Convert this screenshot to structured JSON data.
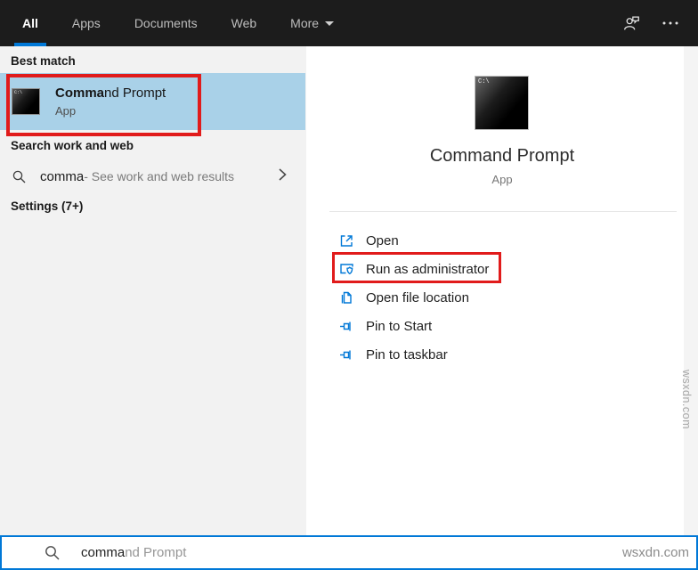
{
  "topbar": {
    "tabs": [
      {
        "label": "All",
        "active": true
      },
      {
        "label": "Apps",
        "active": false
      },
      {
        "label": "Documents",
        "active": false
      },
      {
        "label": "Web",
        "active": false
      },
      {
        "label": "More",
        "active": false,
        "icon": "dropdown-caret-icon"
      }
    ],
    "icons": [
      {
        "name": "feedback-icon"
      },
      {
        "name": "more-options-ellipsis-icon"
      }
    ]
  },
  "left_panel": {
    "best_match_header": "Best match",
    "best_match": {
      "icon": "command-prompt-icon",
      "title_match": "Comma",
      "title_rest": "nd Prompt",
      "type": "App"
    },
    "search_web_header": "Search work and web",
    "web_suggestion": {
      "icon": "search-icon",
      "query": "comma",
      "description": " - See work and web results",
      "chevron": "chevron-right-icon"
    },
    "settings_header": "Settings (7+)"
  },
  "right_panel": {
    "icon": "command-prompt-icon",
    "app_name": "Command Prompt",
    "app_type": "App",
    "actions": [
      {
        "label": "Open",
        "icon": "open-icon"
      },
      {
        "label": "Run as administrator",
        "icon": "shield-window-icon",
        "annotated": true
      },
      {
        "label": "Open file location",
        "icon": "file-location-icon"
      },
      {
        "label": "Pin to Start",
        "icon": "pin-icon"
      },
      {
        "label": "Pin to taskbar",
        "icon": "pin-icon"
      }
    ]
  },
  "search_bar": {
    "icon": "search-icon",
    "typed": "comma",
    "suggestion": "nd Prompt"
  },
  "watermark": {
    "bottom": "wsxdn.com",
    "side": "wsxdn.com"
  },
  "colors": {
    "accent": "#0078d7",
    "highlight": "#a9d1e8",
    "annotation": "#e11b1b",
    "topbar_bg": "#1c1c1c",
    "left_panel_bg": "#f2f2f2"
  },
  "icon_text": {
    "cmd_prompt_mark": "C:\\"
  }
}
